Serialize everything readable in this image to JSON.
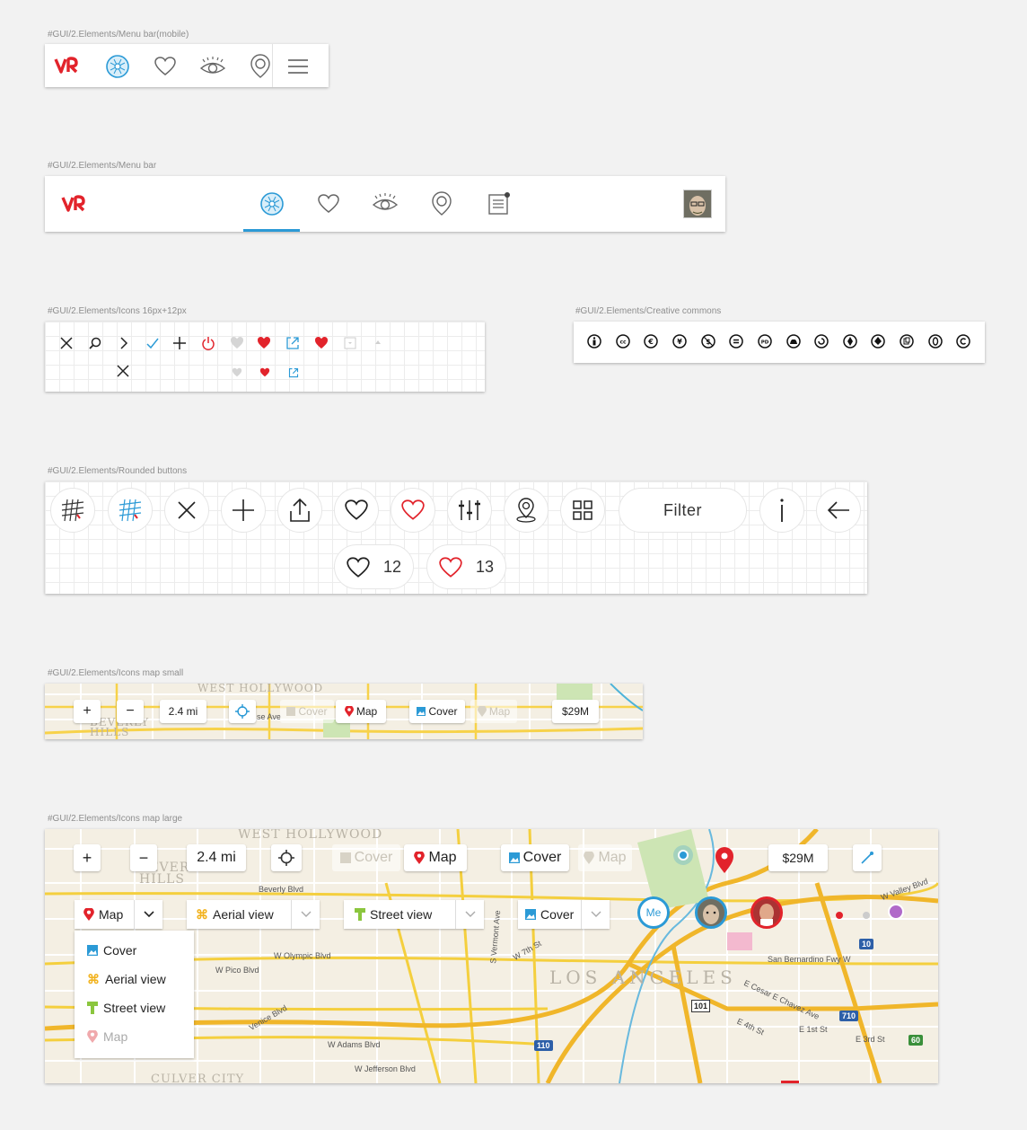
{
  "labels": {
    "menu_mobile": "#GUI/2.Elements/Menu bar(mobile)",
    "menu_bar": "#GUI/2.Elements/Menu bar",
    "icons_small": "#GUI/2.Elements/Icons 16px+12px",
    "creative_commons": "#GUI/2.Elements/Creative commons",
    "rounded_buttons": "#GUI/2.Elements/Rounded buttons",
    "map_small": "#GUI/2.Elements/Icons map small",
    "map_large": "#GUI/2.Elements/Icons map large"
  },
  "brand": {
    "logo_text": "VR",
    "accent": "#2b9ad6",
    "red": "#e2232b"
  },
  "rounded": {
    "filter_label": "Filter",
    "like_count": "12",
    "liked_count": "13"
  },
  "map_small": {
    "zoom_in": "+",
    "zoom_out": "−",
    "distance": "2.4 mi",
    "cover_ghost": "Cover",
    "map": "Map",
    "cover": "Cover",
    "map_ghost": "Map",
    "price": "$29M"
  },
  "map_large": {
    "zoom_in": "+",
    "zoom_out": "−",
    "distance": "2.4 mi",
    "cover_ghost": "Cover",
    "map": "Map",
    "cover": "Cover",
    "map_ghost": "Map",
    "price": "$29M",
    "selects": {
      "map": "Map",
      "aerial": "Aerial view",
      "street": "Street view",
      "cover": "Cover"
    },
    "dropdown": {
      "cover": "Cover",
      "aerial": "Aerial view",
      "street": "Street view",
      "map": "Map"
    },
    "me_marker": "Me",
    "place_labels": {
      "west_hollywood": "WEST HOLLYWOOD",
      "beverly_hills": "BEVERLY HILLS",
      "los_angeles": "LOS ANGELES",
      "culver_city": "CULVER CITY",
      "beverly_blvd": "Beverly Blvd",
      "olympic": "W Olympic Blvd",
      "pico": "W Pico Blvd",
      "venice": "Venice Blvd",
      "adams": "W Adams Blvd",
      "jefferson": "W Jefferson Blvd",
      "vermont": "S Vermont Ave",
      "seventh": "W 7th St",
      "sunset": "San Bernardino Fwy W",
      "chavez": "E Cesar E Chavez Ave",
      "fourth": "E 4th St",
      "third": "E 3rd St",
      "first": "E 1st St",
      "valley": "W Valley Blvd",
      "hwy101": "101",
      "hwy110": "110",
      "hwy10": "10",
      "hwy710": "710",
      "hwy60": "60"
    }
  },
  "map_small_labels": {
    "west_hollywood": "WEST HOLLYWOOD",
    "beverly_hills": "BEVERLY HILLS",
    "avenue": "se Ave"
  }
}
